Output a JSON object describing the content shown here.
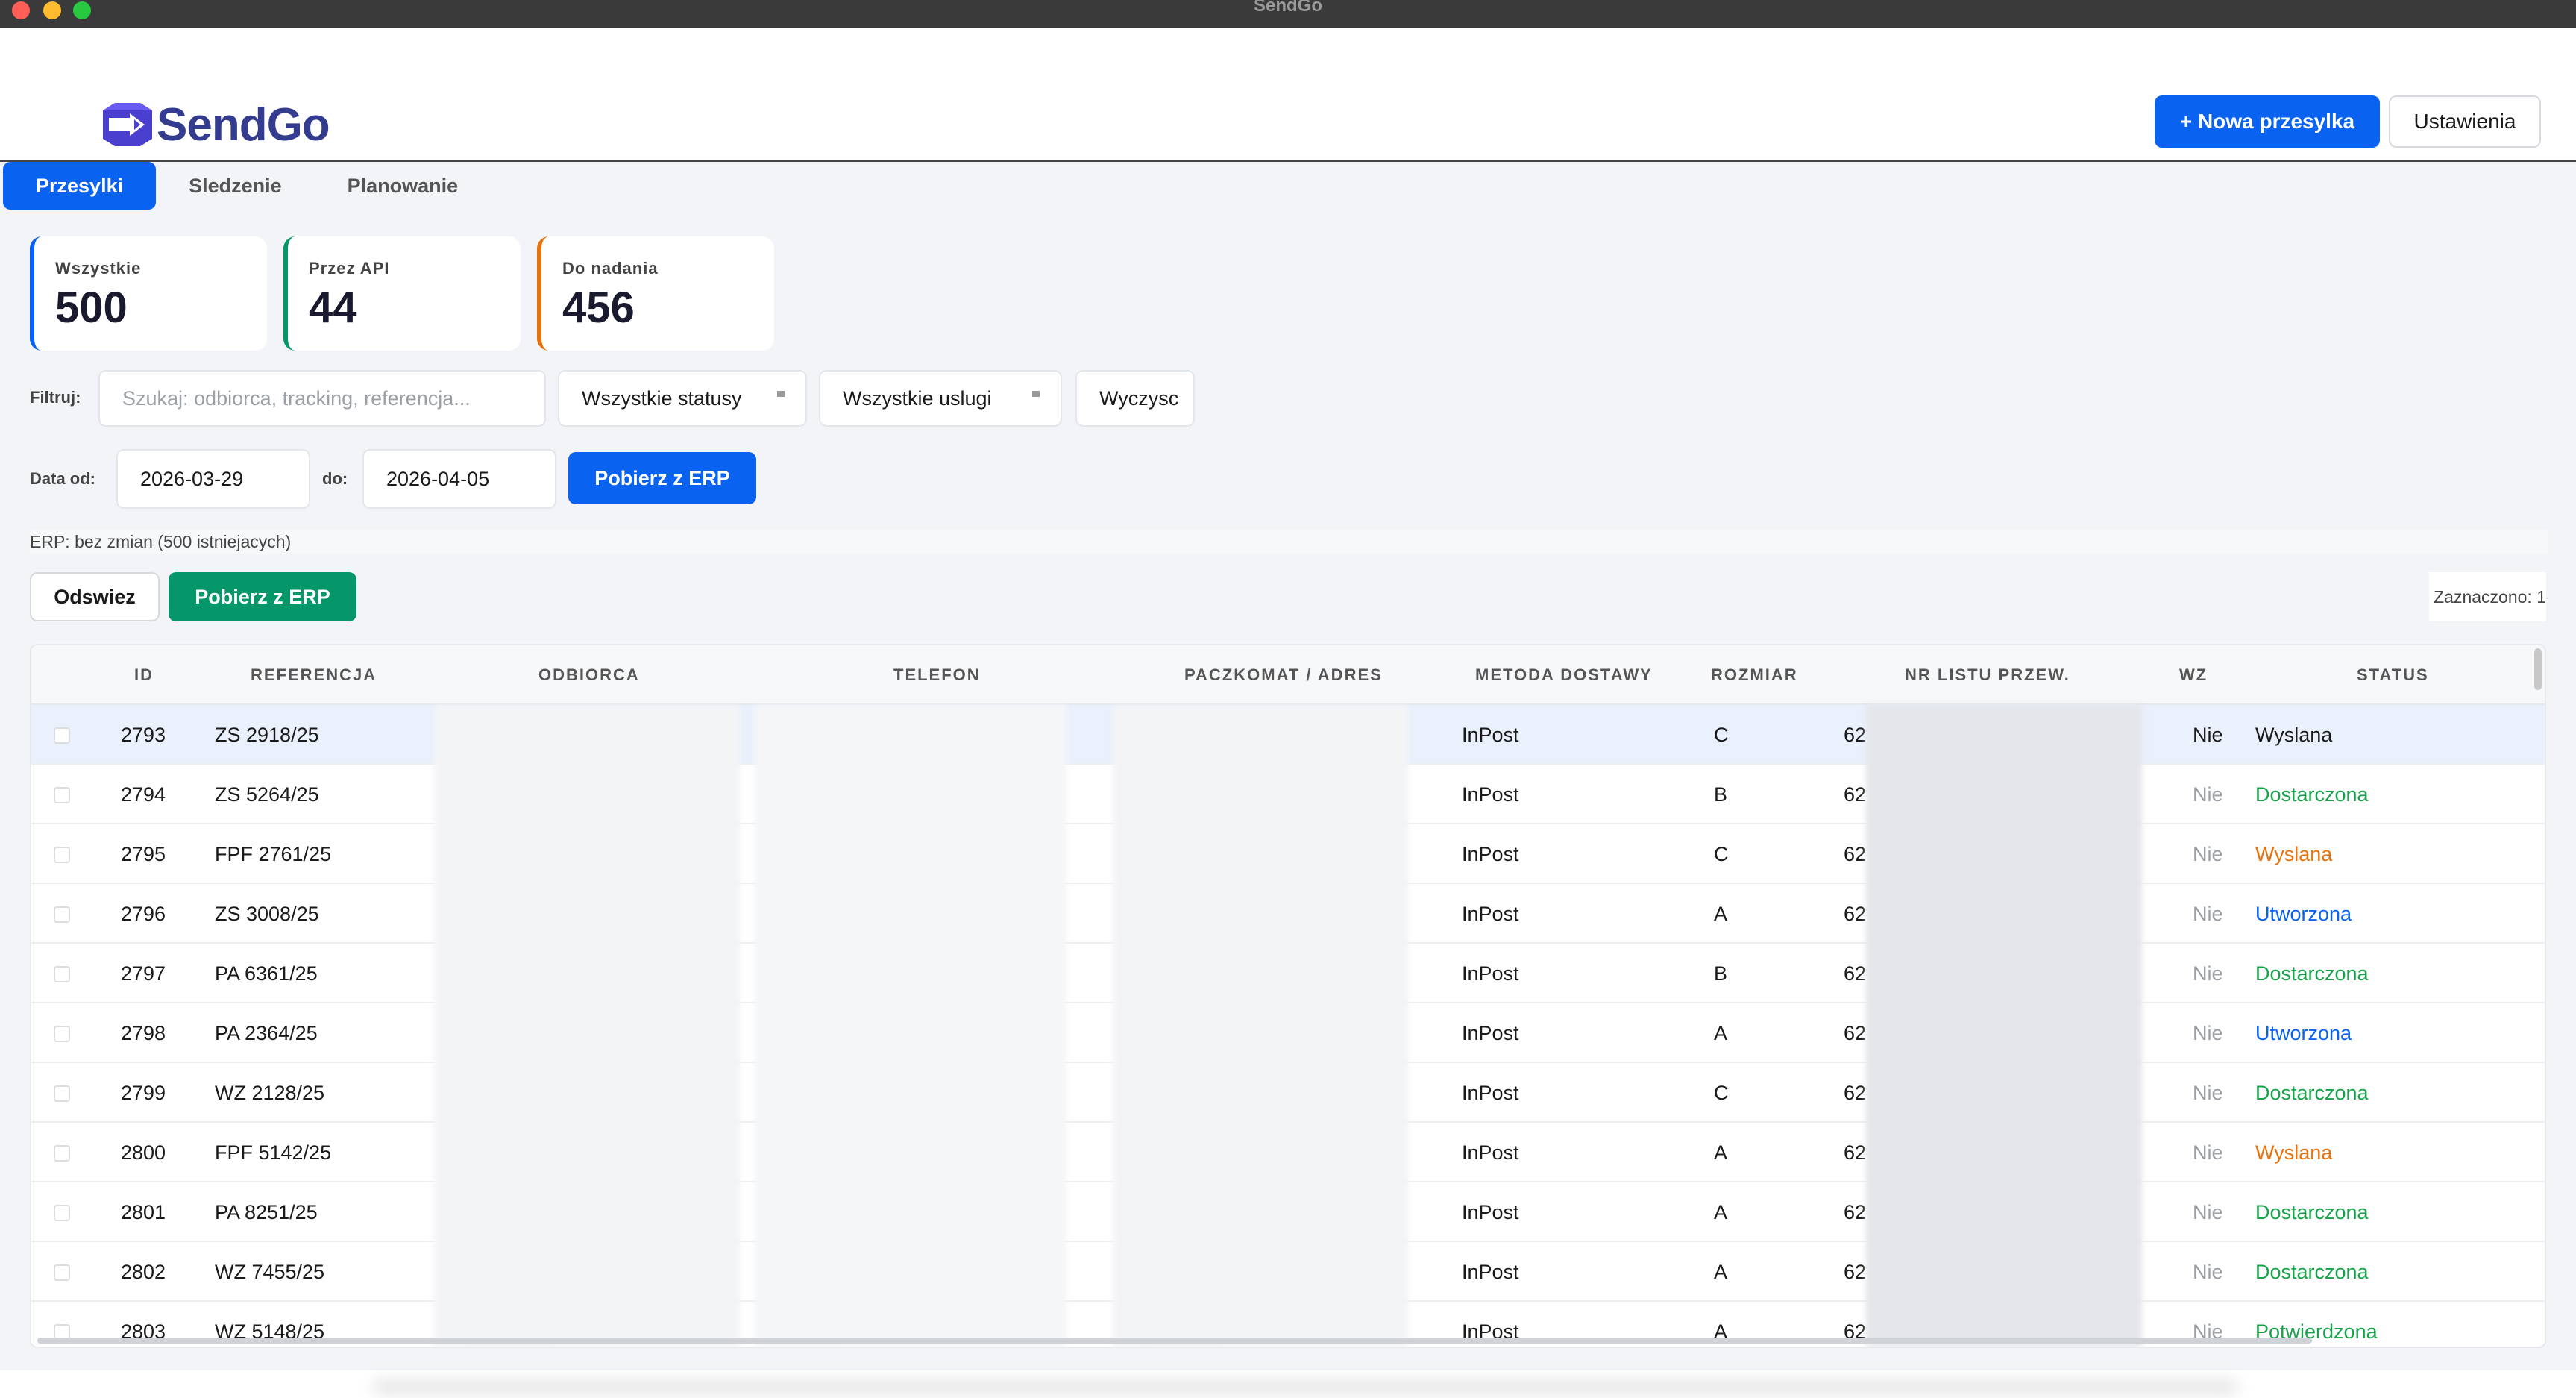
{
  "window": {
    "title": "SendGo"
  },
  "header": {
    "logo_text": "SendGo",
    "new_shipment_label": "+ Nowa przesylka",
    "settings_label": "Ustawienia"
  },
  "tabs": [
    {
      "label": "Przesylki",
      "active": true
    },
    {
      "label": "Sledzenie",
      "active": false
    },
    {
      "label": "Planowanie",
      "active": false
    }
  ],
  "stats": [
    {
      "label": "Wszystkie",
      "value": "500",
      "accent": "#0a63f0"
    },
    {
      "label": "Przez API",
      "value": "44",
      "accent": "#059669"
    },
    {
      "label": "Do nadania",
      "value": "456",
      "accent": "#e8730c"
    }
  ],
  "filters": {
    "filter_label": "Filtruj:",
    "search_placeholder": "Szukaj: odbiorca, tracking, referencja...",
    "status_select": "Wszystkie statusy",
    "service_select": "Wszystkie uslugi",
    "clear_label": "Wyczysc",
    "date_from_label": "Data od:",
    "date_from": "2026-03-29",
    "date_to_label": "do:",
    "date_to": "2026-04-05",
    "fetch_erp_label": "Pobierz z ERP"
  },
  "erp_status": "ERP: bez zmian (500 istniejacych)",
  "actions": {
    "refresh_label": "Odswiez",
    "fetch_erp_label": "Pobierz z ERP",
    "selected_text": "Zaznaczono: 1"
  },
  "table": {
    "columns": [
      "ID",
      "REFERENCJA",
      "ODBIORCA",
      "TELEFON",
      "PACZKOMAT / ADRES",
      "METODA DOSTAWY",
      "ROZMIAR",
      "NR LISTU PRZEW.",
      "WZ",
      "STATUS"
    ],
    "rows": [
      {
        "id": "2793",
        "ref": "ZS 2918/25",
        "method": "InPost",
        "size": "C",
        "tracking": "62",
        "wz": "Nie",
        "status": "Wyslana",
        "status_color": "#1a1a1a",
        "selected": true
      },
      {
        "id": "2794",
        "ref": "ZS 5264/25",
        "method": "InPost",
        "size": "B",
        "tracking": "62",
        "wz": "Nie",
        "status": "Dostarczona",
        "status_color": "#16a34a",
        "selected": false
      },
      {
        "id": "2795",
        "ref": "FPF 2761/25",
        "method": "InPost",
        "size": "C",
        "tracking": "62",
        "wz": "Nie",
        "status": "Wyslana",
        "status_color": "#e8730c",
        "selected": false
      },
      {
        "id": "2796",
        "ref": "ZS 3008/25",
        "method": "InPost",
        "size": "A",
        "tracking": "62",
        "wz": "Nie",
        "status": "Utworzona",
        "status_color": "#0a63f0",
        "selected": false
      },
      {
        "id": "2797",
        "ref": "PA 6361/25",
        "method": "InPost",
        "size": "B",
        "tracking": "62",
        "wz": "Nie",
        "status": "Dostarczona",
        "status_color": "#16a34a",
        "selected": false
      },
      {
        "id": "2798",
        "ref": "PA 2364/25",
        "method": "InPost",
        "size": "A",
        "tracking": "62",
        "wz": "Nie",
        "status": "Utworzona",
        "status_color": "#0a63f0",
        "selected": false
      },
      {
        "id": "2799",
        "ref": "WZ 2128/25",
        "method": "InPost",
        "size": "C",
        "tracking": "62",
        "wz": "Nie",
        "status": "Dostarczona",
        "status_color": "#16a34a",
        "selected": false
      },
      {
        "id": "2800",
        "ref": "FPF 5142/25",
        "method": "InPost",
        "size": "A",
        "tracking": "62",
        "wz": "Nie",
        "status": "Wyslana",
        "status_color": "#e8730c",
        "selected": false
      },
      {
        "id": "2801",
        "ref": "PA 8251/25",
        "method": "InPost",
        "size": "A",
        "tracking": "62",
        "wz": "Nie",
        "status": "Dostarczona",
        "status_color": "#16a34a",
        "selected": false
      },
      {
        "id": "2802",
        "ref": "WZ 7455/25",
        "method": "InPost",
        "size": "A",
        "tracking": "62",
        "wz": "Nie",
        "status": "Dostarczona",
        "status_color": "#16a34a",
        "selected": false
      },
      {
        "id": "2803",
        "ref": "WZ 5148/25",
        "method": "InPost",
        "size": "A",
        "tracking": "62",
        "wz": "Nie",
        "status": "Potwierdzona",
        "status_color": "#16a34a",
        "selected": false
      }
    ]
  },
  "colors": {
    "primary": "#0a63f0",
    "success": "#059669",
    "warning": "#e8730c",
    "logo": "#343c8f"
  },
  "icons": {
    "logo_mark": "send-box-icon",
    "select_arrow": "chevron-down-icon"
  }
}
